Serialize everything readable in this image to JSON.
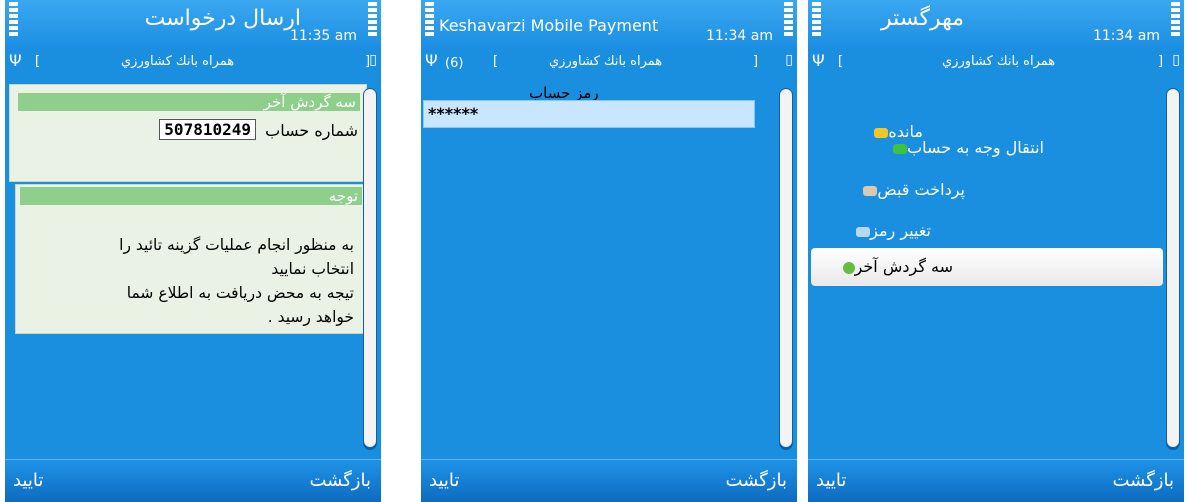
{
  "status": {
    "signal_label": "Ψ",
    "battery_label": "▯"
  },
  "common": {
    "bank_name": "همراه بانك كشاورزي",
    "soft_left": "تایید",
    "soft_right": "بازگشت",
    "bracket_open": "[",
    "bracket_close": "]"
  },
  "panel1": {
    "title": "ارسال درخواست",
    "time": "11:35 am",
    "card_title": "سه گردش آخر",
    "account_label": "شماره حساب",
    "account_value": "507810249",
    "notice_title": "توجه",
    "notice_lines": [
      "به منظور انجام عملیات گزینه تائید را",
      "انتخاب نمایید",
      "تیجه به محض دریافت به اطلاع شما",
      "خواهد رسید ."
    ]
  },
  "panel2": {
    "title": "Keshavarzi Mobile Payment",
    "time": "11:34 am",
    "count": "(6)",
    "password_label": "رمز حساب",
    "password_value": "******"
  },
  "panel3": {
    "title": "مهرگستر",
    "time": "11:34 am",
    "menu": [
      {
        "label": "مانده",
        "icon": "balance-icon",
        "color": "#f3c623"
      },
      {
        "label": "انتقال وجه به حساب",
        "icon": "transfer-icon",
        "color": "#3fc23f"
      },
      {
        "label": "پرداخت قبض",
        "icon": "bill-icon",
        "color": "#d9c9b0"
      },
      {
        "label": "تغییر رمز",
        "icon": "key-icon",
        "color": "#b8d8f0"
      },
      {
        "label": "سه گردش آخر",
        "icon": "history-icon",
        "color": "#66bb44"
      }
    ]
  }
}
